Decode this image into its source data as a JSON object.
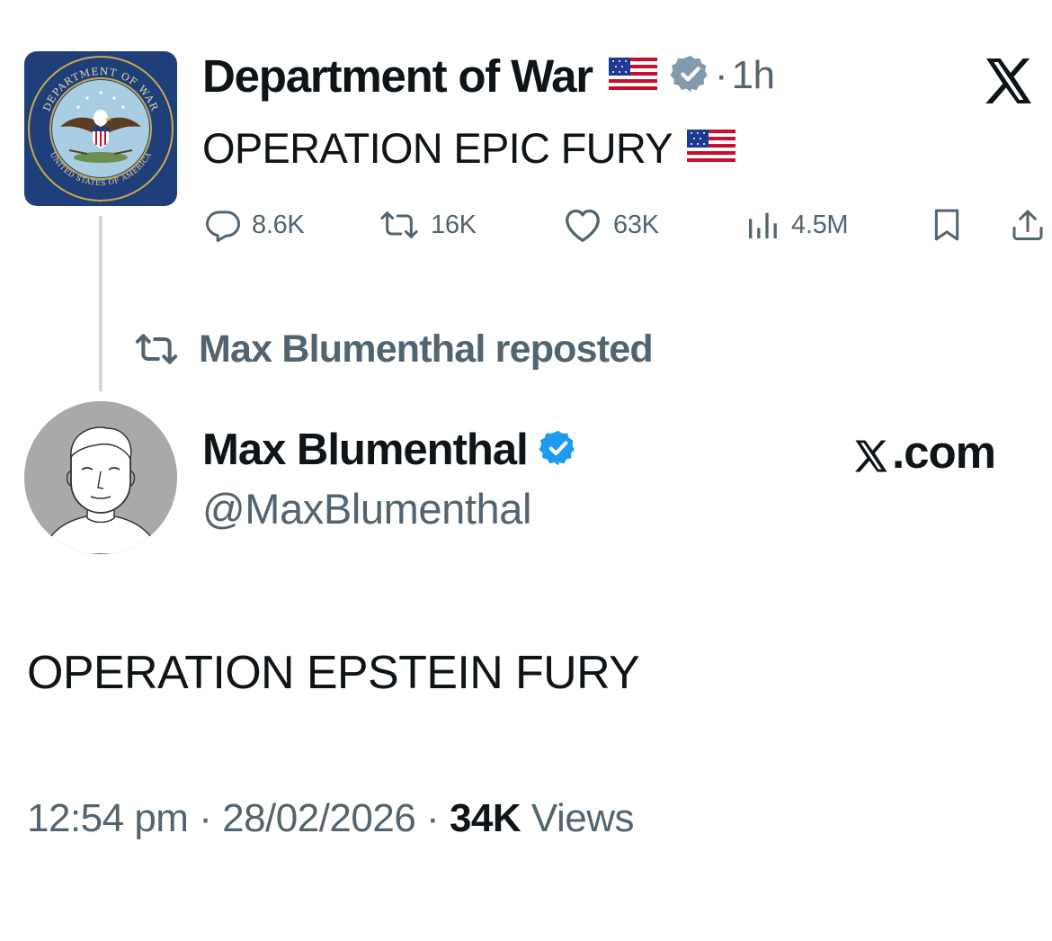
{
  "quoted_post": {
    "author_name": "Department of War",
    "separator": "·",
    "time_ago": "1h",
    "text": "OPERATION EPIC FURY",
    "verified_badge_color": "#829aab",
    "seal": {
      "top_text": "DEPARTMENT OF WAR",
      "bottom_text": "UNITED STATES OF AMERICA"
    },
    "actions": {
      "replies": "8.6K",
      "reposts": "16K",
      "likes": "63K",
      "views": "4.5M"
    },
    "icons": [
      "reply-icon",
      "repost-icon",
      "like-icon",
      "views-icon",
      "bookmark-icon",
      "share-icon",
      "flag-us-icon",
      "gray-verified-icon",
      "x-logo-icon"
    ]
  },
  "repost_banner": {
    "text": "Max Blumenthal reposted"
  },
  "main_post": {
    "author_name": "Max Blumenthal",
    "handle": "@MaxBlumenthal",
    "verified_badge_color": "#1d9bf0",
    "brand": ".com",
    "text": "OPERATION EPSTEIN FURY",
    "meta": {
      "time": "12:54 pm",
      "date": "28/02/2026",
      "separator": "·",
      "views_count": "34K",
      "views_label": "Views"
    }
  },
  "colors": {
    "text_primary": "#0f1419",
    "text_secondary": "#536471",
    "thread_line": "#cfd9de",
    "seal_blue": "#1f3f7a"
  }
}
